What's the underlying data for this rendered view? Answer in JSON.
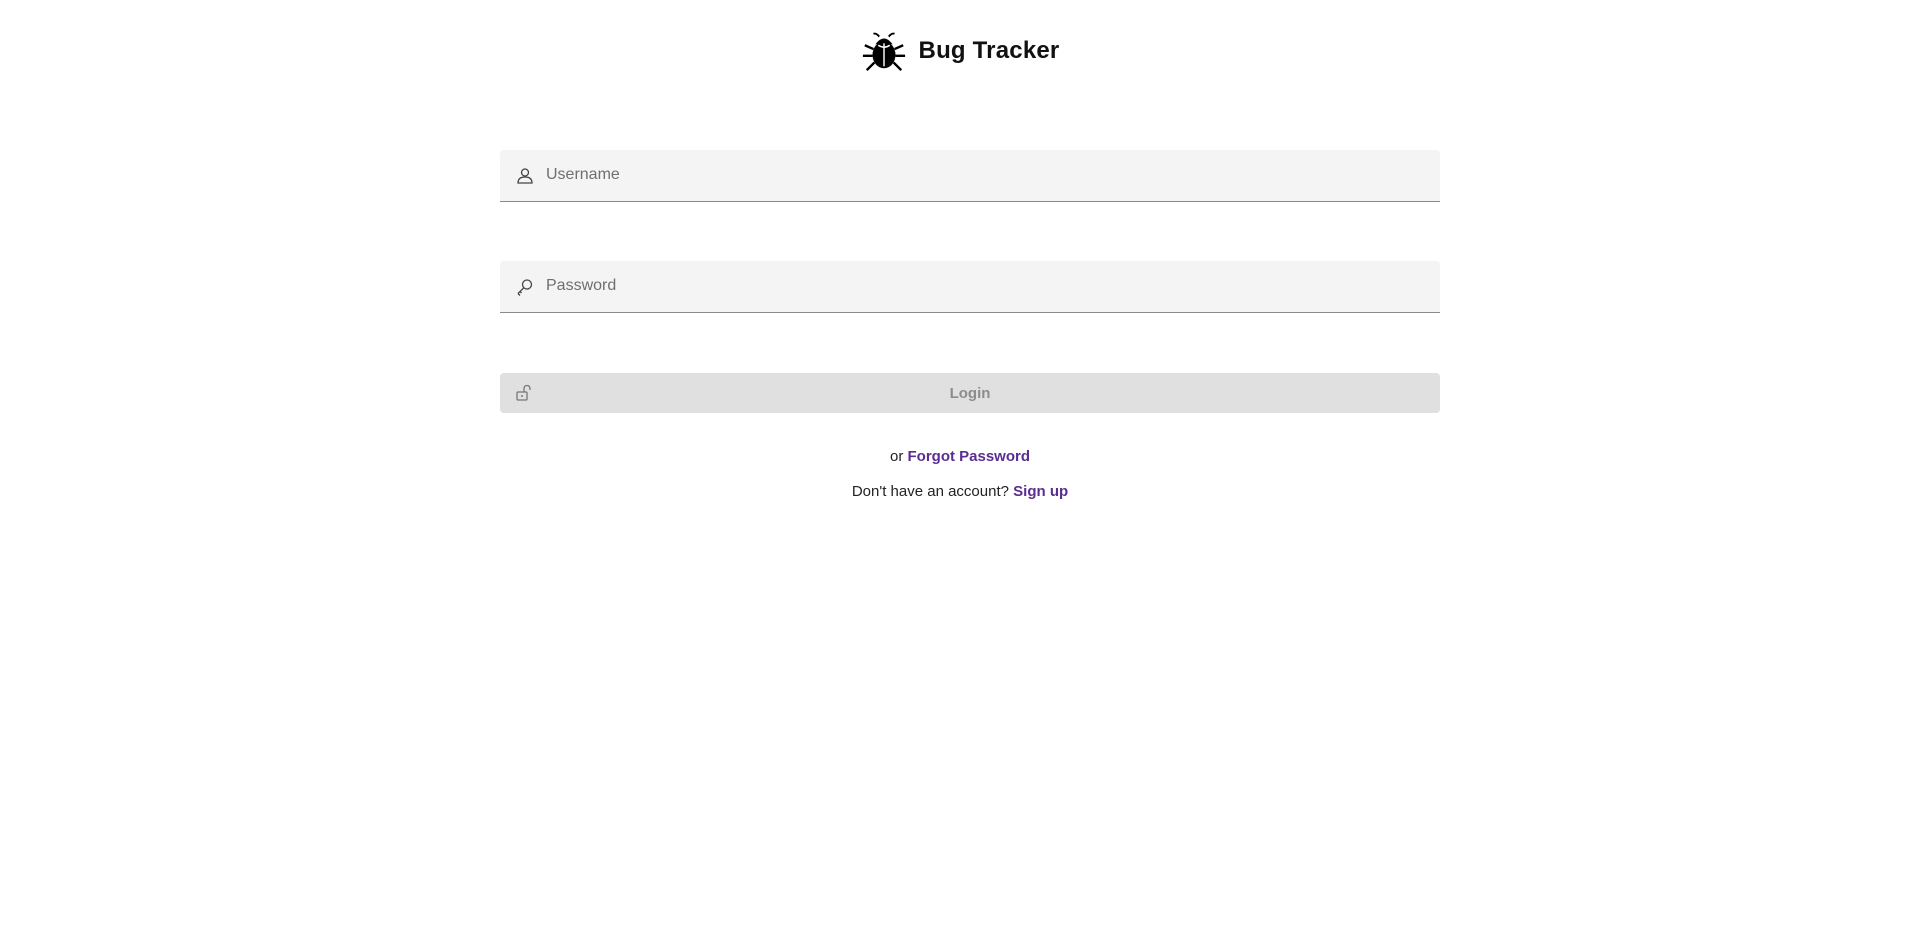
{
  "header": {
    "logo_icon": "bug-icon",
    "title": "Bug Tracker"
  },
  "form": {
    "username": {
      "icon": "user-icon",
      "value": "",
      "placeholder": "Username"
    },
    "password": {
      "icon": "key-icon",
      "value": "",
      "placeholder": "Password"
    },
    "login": {
      "icon": "unlock-icon",
      "label": "Login",
      "enabled": false
    }
  },
  "links": {
    "forgot_prefix": "or",
    "forgot_label": "Forgot Password",
    "signup_prefix": "Don't have an account?",
    "signup_label": "Sign up"
  },
  "colors": {
    "link": "#5b2d90",
    "field_background": "#f4f4f4",
    "button_background": "#e0e0e0",
    "button_text_disabled": "#8c8c8c"
  }
}
